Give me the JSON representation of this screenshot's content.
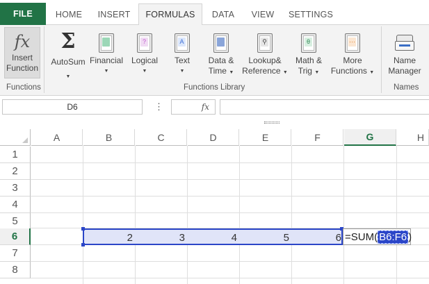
{
  "tabs": {
    "file": "FILE",
    "home": "HOME",
    "insert": "INSERT",
    "formulas": "FORMULAS",
    "data": "DATA",
    "view": "VIEW",
    "settings": "SETTINGS"
  },
  "ribbon": {
    "insert_function": {
      "line1": "Insert",
      "line2": "Function",
      "icon": "fx-icon"
    },
    "group_functions": "Functions",
    "autosum": {
      "label": "AutoSum",
      "icon": "sigma-icon"
    },
    "financial": {
      "label": "Financial",
      "icon": "financial-book-icon"
    },
    "logical": {
      "label": "Logical",
      "icon": "logical-book-icon"
    },
    "text": {
      "label": "Text",
      "icon": "text-book-icon"
    },
    "datetime": {
      "line1": "Data &",
      "line2": "Time",
      "icon": "calendar-book-icon"
    },
    "lookup": {
      "line1": "Lookup&",
      "line2": "Reference",
      "icon": "lookup-book-icon"
    },
    "mathtrig": {
      "line1": "Math &",
      "line2": "Trig",
      "icon": "theta-book-icon"
    },
    "more": {
      "line1": "More",
      "line2": "Functions",
      "icon": "more-book-icon"
    },
    "group_library": "Functions Library",
    "name_manager": {
      "line1": "Name",
      "line2": "Manager",
      "icon": "name-manager-icon"
    },
    "group_names": "Names"
  },
  "formula_bar": {
    "name_box": "D6",
    "dots": "⋮",
    "fx": "fx",
    "content": ""
  },
  "sheet": {
    "columns": [
      "A",
      "B",
      "C",
      "D",
      "E",
      "F",
      "G",
      "H"
    ],
    "rows": [
      "1",
      "2",
      "3",
      "4",
      "5",
      "6",
      "7",
      "8"
    ],
    "selected_column": "G",
    "selected_row": "6",
    "values": {
      "B6": "2",
      "C6": "3",
      "D6": "4",
      "E6": "5",
      "F6": "6"
    },
    "edit_cell": {
      "prefix": "=SUM(",
      "ref": "B6:F6",
      "suffix": ")"
    }
  },
  "colors": {
    "file_tab": "#217346",
    "selection_border": "#2b46c8",
    "selection_fill": "#e0e4f8"
  }
}
